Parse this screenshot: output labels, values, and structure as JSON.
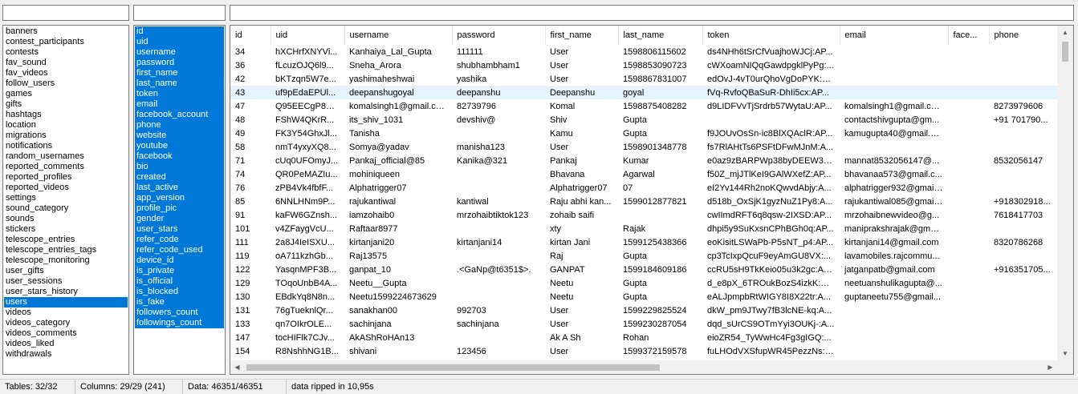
{
  "filters": {
    "tables_value": "",
    "columns_value": "",
    "data_value": ""
  },
  "tables": {
    "items": [
      "banners",
      "contest_participants",
      "contests",
      "fav_sound",
      "fav_videos",
      "follow_users",
      "games",
      "gifts",
      "hashtags",
      "location",
      "migrations",
      "notifications",
      "random_usernames",
      "reported_comments",
      "reported_profiles",
      "reported_videos",
      "settings",
      "sound_category",
      "sounds",
      "stickers",
      "telescope_entries",
      "telescope_entries_tags",
      "telescope_monitoring",
      "user_gifts",
      "user_sessions",
      "user_stars_history",
      "users",
      "videos",
      "videos_category",
      "videos_comments",
      "videos_liked",
      "withdrawals"
    ],
    "selected_index": 26
  },
  "columns": {
    "items": [
      "id",
      "uid",
      "username",
      "password",
      "first_name",
      "last_name",
      "token",
      "email",
      "facebook_account",
      "phone",
      "website",
      "youtube",
      "facebook",
      "bio",
      "created",
      "last_active",
      "app_version",
      "profile_pic",
      "gender",
      "user_stars",
      "refer_code",
      "refer_code_used",
      "device_id",
      "is_private",
      "is_official",
      "is_blocked",
      "is_fake",
      "followers_count",
      "followings_count"
    ],
    "all_selected": true
  },
  "grid": {
    "headers": [
      "id",
      "uid",
      "username",
      "password",
      "first_name",
      "last_name",
      "token",
      "email",
      "face...",
      "phone"
    ],
    "highlight_row": 3,
    "rows": [
      [
        "34",
        "hXCHrfXNYVi...",
        "Kanhaiya_Lal_Gupta",
        "111111",
        "User",
        "1598806115602",
        "ds4NHh6tSrCfVuajhoWJCj:AP...",
        "",
        "",
        " "
      ],
      [
        "36",
        "fLcuzOJQ6l9...",
        "Sneha_Arora",
        "shubhambham1",
        "User",
        "1598853090723",
        "cWXoamNIQqGawdpgklPyPg:...",
        "",
        "",
        ""
      ],
      [
        "42",
        "bKTzqn5W7e...",
        "yashimaheshwai",
        "yashika",
        "User",
        "1598867831007",
        "edOvJ-4vT0urQhoVgDoPYK:A...",
        "",
        "",
        ""
      ],
      [
        "43",
        "uf9pEdaEPUl...",
        "deepanshugoyal",
        "deepanshu",
        "Deepanshu",
        "goyal",
        "fVq-RvfoQBaSuR-DhIi5cx:AP...",
        "",
        "",
        ""
      ],
      [
        "47",
        "Q95EECgP8U...",
        "komalsingh1@gmail.com",
        "82739796",
        "Komal",
        "1598875408282",
        "d9LIDFVvTjSrdrb57WytaU:AP...",
        "komalsingh1@gmail.com",
        "",
        "8273979606"
      ],
      [
        "48",
        "FShW4QKrR...",
        "its_shiv_1031",
        "devshiv@",
        "Shiv",
        "Gupta",
        "",
        "contactshivgupta@gm...",
        "",
        "+91 701790..."
      ],
      [
        "49",
        "FK3Y54GhxJl...",
        "Tanisha",
        "",
        "Kamu",
        "Gupta",
        "f9JOUvOsSn-ic8BlXQAclR:AP...",
        "kamugupta40@gmail.com",
        "",
        ""
      ],
      [
        "58",
        "nmT4yxyXQ8...",
        "Somya@yadav",
        "manisha123",
        "User",
        "1598901348778",
        "fs7RlAHtTs6PSFtDFwMJnM:A...",
        "",
        "",
        ""
      ],
      [
        "71",
        "cUq0UFOmyJ...",
        "Pankaj_official@85",
        "Kanika@321",
        "Pankaj",
        "Kumar",
        "e0az9zBARPWp38byDEEW3L:...",
        "mannat8532056147@...",
        "",
        "8532056147"
      ],
      [
        "74",
        "QR0PeMAZIu...",
        "mohiniqueen",
        "",
        "Bhavana",
        "Agarwal",
        "f50Z_mjJTlKeI9GAlWXefZ:AP...",
        "bhavanaa573@gmail.c...",
        "",
        ""
      ],
      [
        "76",
        "zPB4Vk4fbfF...",
        "Alphatrigger07",
        "",
        "Alphatrigger07",
        "07",
        "eI2Yv144Rh2noKQwvdAbjy:A...",
        "alphatrigger932@gmail...",
        "",
        ""
      ],
      [
        "85",
        "6NNLHNm9P...",
        "rajukantiwal",
        "kantiwal",
        "Raju abhi kan...",
        "1599012877821",
        "d518b_OxSjK1gyzNuZ1Py8:A...",
        "rajukantiwal085@gmail...",
        "",
        "+918302918..."
      ],
      [
        "91",
        "kaFW6GZnsh...",
        "iamzohaib0",
        "mrzohaibtiktok123",
        "zohaib saifi",
        "",
        "cwIImdRFT6q8qsw-2IXSD:AP...",
        "mrzohaibnewvideo@g...",
        "",
        "7618417703"
      ],
      [
        "101",
        "v4ZFaygVcU...",
        "Raftaar8977",
        "",
        "xty",
        "Rajak",
        "dhpi5y9SuKxsnCPhBGh0q:AP...",
        "maniprakshrajak@gmai...",
        "",
        ""
      ],
      [
        "111",
        "2a8J4IeISXU...",
        "kirtanjani20",
        "kirtanjani14",
        "kirtan Jani",
        "1599125438366",
        "eoKisitLSWaPb-P5sNT_p4:AP...",
        "kirtanjani14@gmail.com",
        "",
        "8320786268"
      ],
      [
        "119",
        "oA711kzhGb...",
        "Raj13575",
        "",
        "Raj",
        "Gupta",
        "cp3TcIxpQcuF9eyAmGU8VX:...",
        "lavamobiles.rajcommu...",
        "",
        ""
      ],
      [
        "122",
        "YasqnMPF3B...",
        "ganpat_10",
        ".<GaNp@t6351$>.",
        "GANPAT",
        "1599184609186",
        "ccRU5sH9TkKeio05u3k2gc:AP...",
        "jatganpatb@gmail.com",
        "",
        "+916351705..."
      ],
      [
        "129",
        "TOqoUnbB4A...",
        "Neetu__Gupta",
        "",
        "Neetu",
        "Gupta",
        "d_e8pX_6TROukBozS4izkK:AP...",
        "neetuanshulikagupta@...",
        "",
        ""
      ],
      [
        "130",
        "EBdkYq8N8n...",
        "Neetu1599224673629",
        "",
        "Neetu",
        "Gupta",
        "eALJpmpbRtWIGY8I8X22tr:A...",
        "guptaneetu755@gmail...",
        "",
        ""
      ],
      [
        "131",
        "76gTueknlQr...",
        "sanakhan00",
        "992703",
        "User",
        "1599229825524",
        "dkW_pm9JTwy7fB3lcNE-kq:A...",
        "",
        "",
        ""
      ],
      [
        "133",
        "qn7OIkrOLE...",
        "sachinjana",
        "sachinjana",
        "User",
        "1599230287054",
        "dqd_sUrCS9OTmYyi3OUKj-:A...",
        "",
        "",
        ""
      ],
      [
        "147",
        "tocHIFlk7CJv...",
        "AkAShRoHAn13",
        "",
        "Ak A Sh",
        "Rohan",
        "eioZR54_TyWwHc4Fg3gIGQ:...",
        "",
        "",
        ""
      ],
      [
        "154",
        "R8NshhNG1B...",
        "shivani",
        "123456",
        "User",
        "1599372159578",
        "fuLHOdVXSfupWR45PezzNs:A...",
        "",
        "",
        ""
      ]
    ]
  },
  "status": {
    "tables": "Tables: 32/32",
    "columns": "Columns: 29/29 (241)",
    "data": "Data: 46351/46351",
    "message": "data ripped in 10,95s"
  }
}
